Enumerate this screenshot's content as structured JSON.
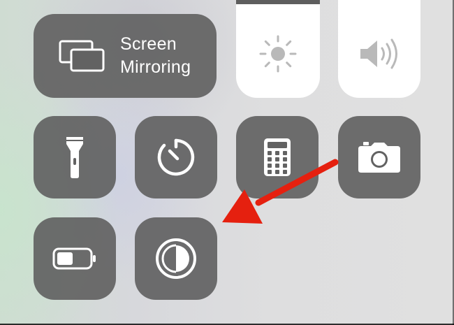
{
  "control_center": {
    "screen_mirroring": {
      "line1": "Screen",
      "line2": "Mirroring",
      "icon": "screen-mirroring-icon"
    },
    "brightness": {
      "icon": "sun-icon"
    },
    "volume": {
      "icon": "speaker-icon"
    },
    "toggles": [
      {
        "name": "flashlight",
        "icon": "flashlight-icon"
      },
      {
        "name": "timer",
        "icon": "timer-icon"
      },
      {
        "name": "calculator",
        "icon": "calculator-icon"
      },
      {
        "name": "camera",
        "icon": "camera-icon"
      },
      {
        "name": "low-power-mode",
        "icon": "battery-icon"
      },
      {
        "name": "invert-colors",
        "icon": "contrast-icon"
      }
    ]
  },
  "annotation": {
    "color": "#e5200f"
  },
  "colors": {
    "tile": "#626262",
    "slider": "#ffffff",
    "icon": "#ffffff",
    "slider_icon": "#b9b9b9"
  }
}
